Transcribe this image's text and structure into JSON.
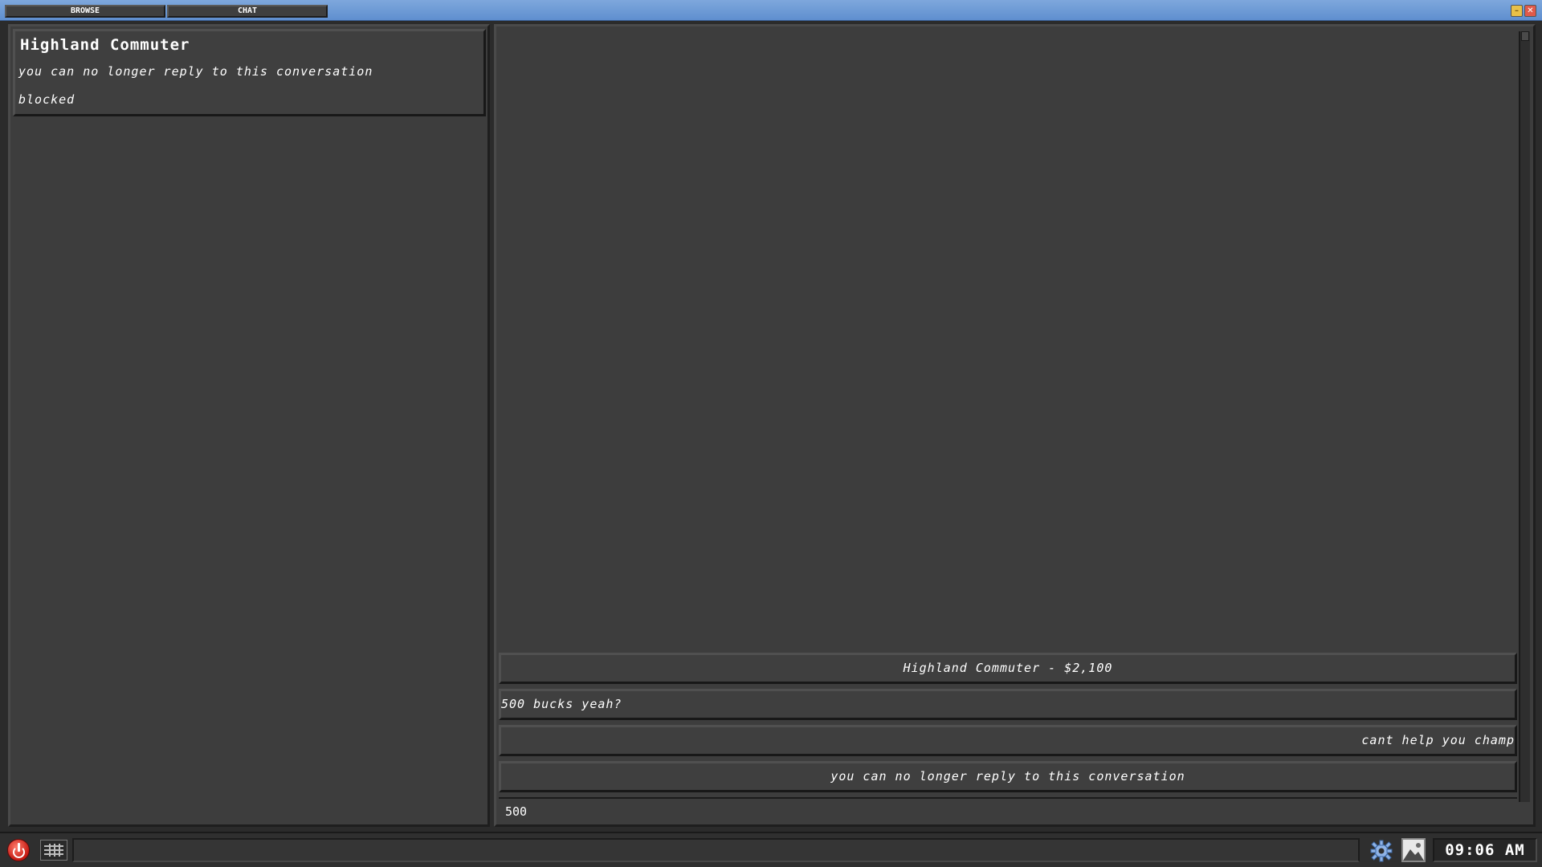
{
  "tabs": {
    "browse": "BROWSE",
    "chat": "CHAT"
  },
  "window_controls": {
    "minimize_icon": "minimize-icon",
    "close_icon": "close-icon"
  },
  "conversation_list": [
    {
      "title": "Highland Commuter",
      "snippet": "you can no longer reply to this conversation",
      "status": "blocked"
    }
  ],
  "chat": {
    "header": "Highland Commuter - $2,100",
    "messages": [
      {
        "text": "500 bucks yeah?",
        "side": "left"
      },
      {
        "text": "cant help you champ",
        "side": "right"
      },
      {
        "text": "you can no longer reply to this conversation",
        "side": "center"
      }
    ],
    "input_value": "500"
  },
  "taskbar": {
    "power_icon": "power-icon",
    "grid_icon": "grid-icon",
    "settings_icon": "gear-icon",
    "wallpaper_icon": "image-icon",
    "clock": "09:06 AM"
  }
}
